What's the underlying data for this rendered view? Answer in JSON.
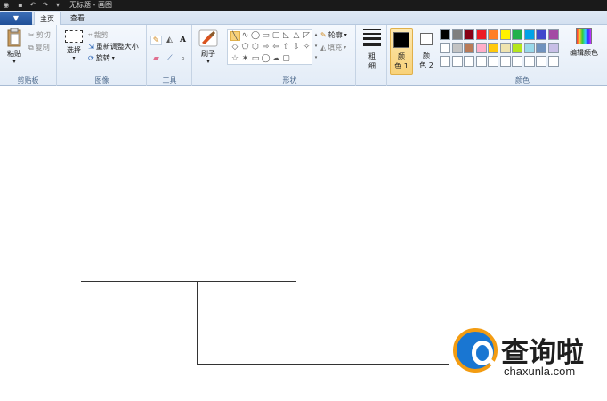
{
  "window": {
    "title": "无标题 - 画图"
  },
  "menu": {
    "file_label": "▼"
  },
  "tabs": [
    {
      "label": "主页"
    },
    {
      "label": "查看"
    }
  ],
  "clipboard": {
    "group_label": "剪贴板",
    "paste_label": "粘贴",
    "cut_label": "剪切",
    "copy_label": "复制"
  },
  "image": {
    "group_label": "图像",
    "select_label": "选择",
    "crop_label": "裁剪",
    "resize_label": "重新调整大小",
    "rotate_label": "旋转"
  },
  "tools": {
    "group_label": "工具",
    "items": [
      "pencil-icon",
      "fill-icon",
      "text-icon",
      "eraser-icon",
      "color-picker-icon",
      "magnifier-icon"
    ],
    "text_glyph": "A"
  },
  "brushes": {
    "label": "刷子"
  },
  "shapes": {
    "group_label": "形状",
    "outline_label": "轮廓",
    "fill_label": "填充",
    "glyphs": [
      "╲",
      "∿",
      "◯",
      "▭",
      "▢",
      "◺",
      "△",
      "◸",
      "◇",
      "⬠",
      "⬡",
      "⇨",
      "⇦",
      "⇧",
      "⇩",
      "✧",
      "☆",
      "✶",
      "▭",
      "◯",
      "☁",
      "▢"
    ]
  },
  "size": {
    "label_line1": "粗",
    "label_line2": "细"
  },
  "color1": {
    "label_line1": "颜",
    "label_line2": "色 1",
    "value": "#000000"
  },
  "color2": {
    "label_line1": "颜",
    "label_line2": "色 2",
    "value": "#ffffff"
  },
  "palette": {
    "group_label": "颜色",
    "edit_label": "编辑颜色",
    "row1": [
      "#000000",
      "#7f7f7f",
      "#880015",
      "#ed1c24",
      "#ff7f27",
      "#fff200",
      "#22b14c",
      "#00a2e8",
      "#3f48cc",
      "#a349a4"
    ],
    "row2": [
      "#ffffff",
      "#c3c3c3",
      "#b97a57",
      "#ffaec9",
      "#ffc90e",
      "#efe4b0",
      "#b5e61d",
      "#99d9ea",
      "#7092be",
      "#c8bfe7"
    ],
    "row3": [
      "#ffffff",
      "#ffffff",
      "#ffffff",
      "#ffffff",
      "#ffffff",
      "#ffffff",
      "#ffffff",
      "#ffffff",
      "#ffffff",
      "#ffffff"
    ]
  },
  "watermark": {
    "title": "查询啦",
    "url": "chaxunla.com"
  }
}
